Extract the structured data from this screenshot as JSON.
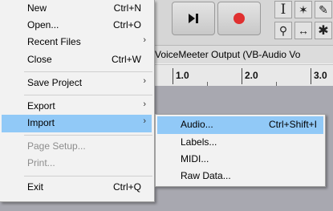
{
  "background": {
    "device_text": "VoiceMeeter Output (VB-Audio Vo",
    "ruler_labels": [
      "1.0",
      "2.0",
      "3.0"
    ]
  },
  "menu": {
    "items": [
      {
        "label": "New",
        "shortcut": "Ctrl+N"
      },
      {
        "label": "Open...",
        "shortcut": "Ctrl+O"
      },
      {
        "label": "Recent Files",
        "submenu": true
      },
      {
        "label": "Close",
        "shortcut": "Ctrl+W"
      },
      {
        "label": "Save Project",
        "submenu": true
      },
      {
        "label": "Export",
        "submenu": true
      },
      {
        "label": "Import",
        "submenu": true,
        "highlighted": true
      },
      {
        "label": "Page Setup...",
        "disabled": true
      },
      {
        "label": "Print...",
        "disabled": true
      },
      {
        "label": "Exit",
        "shortcut": "Ctrl+Q"
      }
    ],
    "submenu_arrow": "›"
  },
  "import_submenu": {
    "items": [
      {
        "label": "Audio...",
        "shortcut": "Ctrl+Shift+I",
        "highlighted": true
      },
      {
        "label": "Labels..."
      },
      {
        "label": "MIDI..."
      },
      {
        "label": "Raw Data..."
      }
    ]
  },
  "colors": {
    "highlight": "#91c9f7",
    "record_red": "#e03030",
    "disabled_text": "#8d8d8d"
  }
}
